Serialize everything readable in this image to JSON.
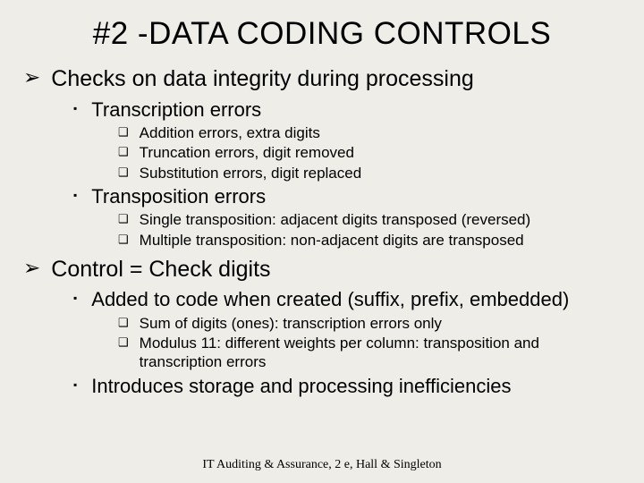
{
  "title": "#2 -DATA CODING CONTROLS",
  "footer": "IT Auditing & Assurance, 2 e, Hall & Singleton",
  "outline": [
    {
      "level": 1,
      "text": "Checks on data integrity during processing",
      "children": [
        {
          "level": 2,
          "text": "Transcription errors",
          "children": [
            {
              "level": 3,
              "text": "Addition errors, extra digits"
            },
            {
              "level": 3,
              "text": "Truncation errors, digit removed"
            },
            {
              "level": 3,
              "text": "Substitution errors, digit replaced"
            }
          ]
        },
        {
          "level": 2,
          "text": "Transposition errors",
          "children": [
            {
              "level": 3,
              "text": "Single transposition: adjacent digits transposed (reversed)"
            },
            {
              "level": 3,
              "text": "Multiple transposition: non-adjacent digits are transposed"
            }
          ]
        }
      ]
    },
    {
      "level": 1,
      "text": "Control = Check digits",
      "children": [
        {
          "level": 2,
          "text": "Added to code when created (suffix, prefix, embedded)",
          "children": [
            {
              "level": 3,
              "text": "Sum of digits (ones): transcription errors only"
            },
            {
              "level": 3,
              "text": "Modulus 11: different weights per column: transposition and transcription errors"
            }
          ]
        },
        {
          "level": 2,
          "text": "Introduces storage and processing inefficiencies"
        }
      ]
    }
  ]
}
